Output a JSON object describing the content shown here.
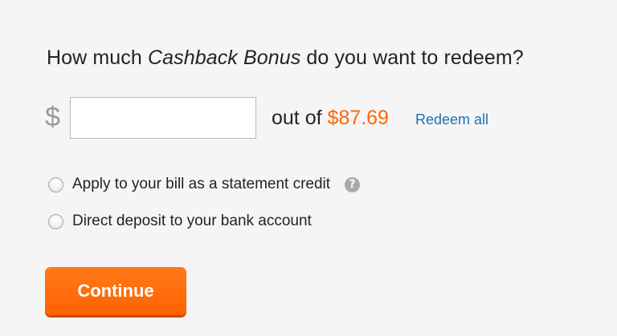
{
  "question": {
    "prefix": "How much ",
    "emphasis": "Cashback Bonus",
    "suffix": " do you want to redeem?"
  },
  "amount": {
    "currency_symbol": "$",
    "input_value": "",
    "out_of_label": "out of ",
    "available_balance": "$87.69",
    "redeem_all_label": "Redeem all"
  },
  "options": [
    {
      "label": "Apply to your bill as a statement credit",
      "selected": false,
      "has_help": true
    },
    {
      "label": "Direct deposit to your bank account",
      "selected": false,
      "has_help": false
    }
  ],
  "help_icon_glyph": "?",
  "actions": {
    "continue_label": "Continue"
  },
  "colors": {
    "accent_orange": "#ff6600",
    "link_blue": "#1a73b5",
    "background": "#f5f5f5"
  },
  "icons": {
    "help": "question-mark-circle-icon"
  }
}
